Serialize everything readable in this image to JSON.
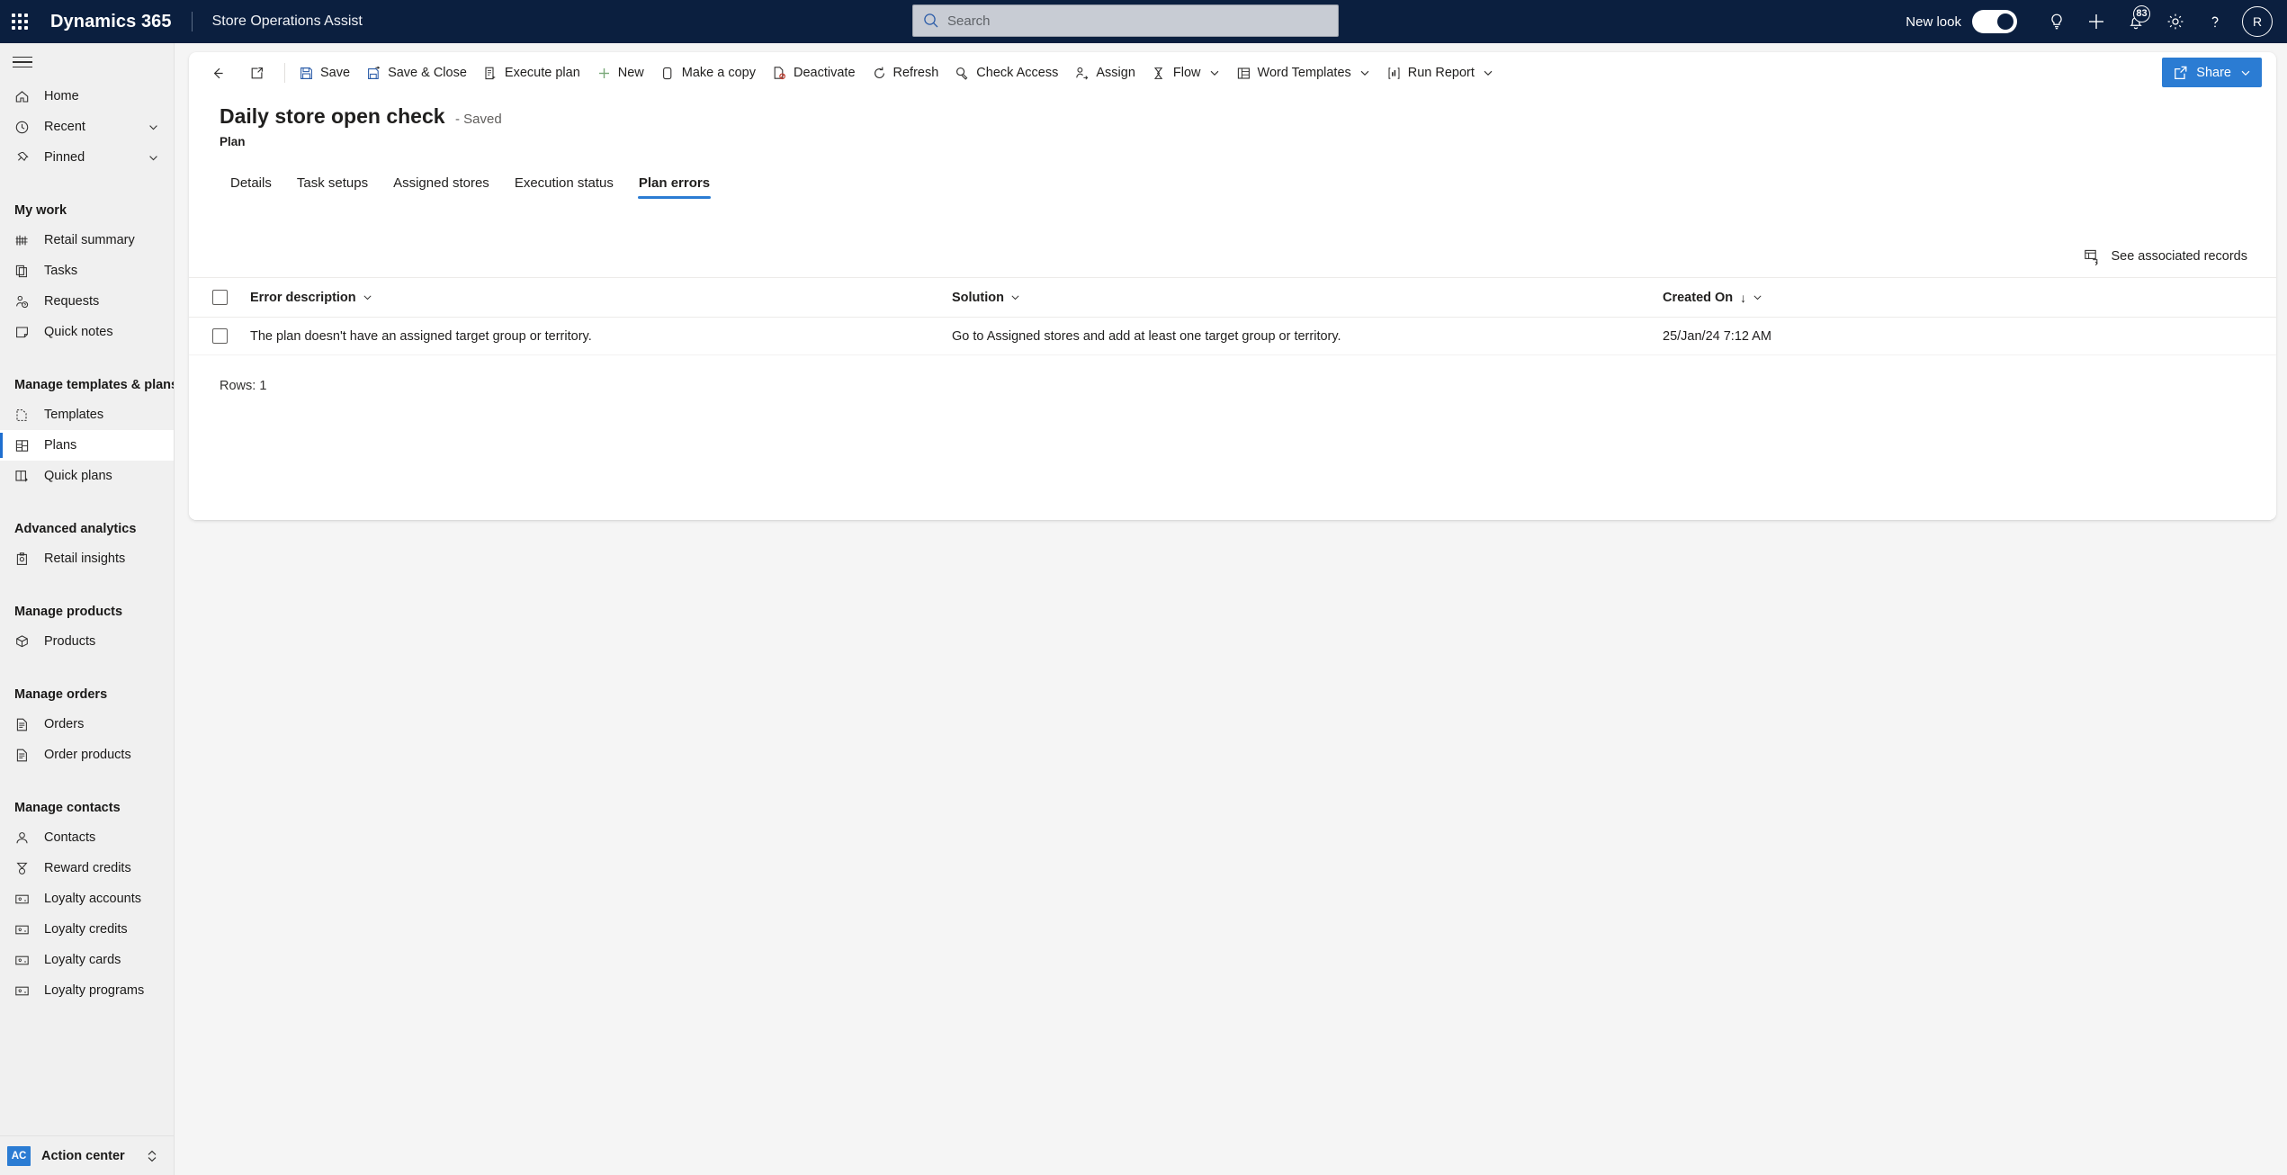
{
  "header": {
    "waffle_name": "app-launcher",
    "brand": "Dynamics 365",
    "app_name": "Store Operations Assist",
    "search_placeholder": "Search",
    "search_value": "",
    "new_look_label": "New look",
    "new_look_on": true,
    "notification_count": "83",
    "avatar_initials": "R",
    "icons": [
      "lightbulb-icon",
      "plus-icon",
      "bell-icon",
      "gear-icon",
      "help-icon"
    ]
  },
  "sidebar": {
    "top_items": [
      {
        "label": "Home",
        "icon": "home-icon",
        "chevron": false,
        "selected": false
      },
      {
        "label": "Recent",
        "icon": "clock-icon",
        "chevron": true,
        "selected": false
      },
      {
        "label": "Pinned",
        "icon": "pin-icon",
        "chevron": true,
        "selected": false
      }
    ],
    "groups": [
      {
        "title": "My work",
        "items": [
          {
            "label": "Retail summary",
            "icon": "dashboard-icon",
            "selected": false
          },
          {
            "label": "Tasks",
            "icon": "copy-icon",
            "selected": false
          },
          {
            "label": "Requests",
            "icon": "person-help-icon",
            "selected": false
          },
          {
            "label": "Quick notes",
            "icon": "note-icon",
            "selected": false
          }
        ]
      },
      {
        "title": "Manage templates & plans",
        "items": [
          {
            "label": "Templates",
            "icon": "template-icon",
            "selected": false
          },
          {
            "label": "Plans",
            "icon": "plan-icon",
            "selected": true
          },
          {
            "label": "Quick plans",
            "icon": "quick-plan-icon",
            "selected": false
          }
        ]
      },
      {
        "title": "Advanced analytics",
        "items": [
          {
            "label": "Retail insights",
            "icon": "insights-icon",
            "selected": false
          }
        ]
      },
      {
        "title": "Manage products",
        "items": [
          {
            "label": "Products",
            "icon": "box-icon",
            "selected": false
          }
        ]
      },
      {
        "title": "Manage orders",
        "items": [
          {
            "label": "Orders",
            "icon": "document-icon",
            "selected": false
          },
          {
            "label": "Order products",
            "icon": "document-icon",
            "selected": false
          }
        ]
      },
      {
        "title": "Manage contacts",
        "items": [
          {
            "label": "Contacts",
            "icon": "person-icon",
            "selected": false
          },
          {
            "label": "Reward credits",
            "icon": "medal-icon",
            "selected": false
          },
          {
            "label": "Loyalty accounts",
            "icon": "card-icon",
            "selected": false
          },
          {
            "label": "Loyalty credits",
            "icon": "card-icon",
            "selected": false
          },
          {
            "label": "Loyalty cards",
            "icon": "card-icon",
            "selected": false
          },
          {
            "label": "Loyalty programs",
            "icon": "card-icon",
            "selected": false
          }
        ]
      }
    ],
    "action_center": {
      "badge": "AC",
      "label": "Action center",
      "icon": "expand-collapse-icon"
    }
  },
  "command_bar": {
    "back_icon": "back-arrow-icon",
    "popout_icon": "open-in-new-window-icon",
    "commands": [
      {
        "label": "Save",
        "icon": "save-icon",
        "chevron": false
      },
      {
        "label": "Save & Close",
        "icon": "save-close-icon",
        "chevron": false
      },
      {
        "label": "Execute plan",
        "icon": "execute-icon",
        "chevron": false
      },
      {
        "label": "New",
        "icon": "plus-icon",
        "chevron": false
      },
      {
        "label": "Make a copy",
        "icon": "copy-icon",
        "chevron": false
      },
      {
        "label": "Deactivate",
        "icon": "deactivate-icon",
        "chevron": false
      },
      {
        "label": "Refresh",
        "icon": "refresh-icon",
        "chevron": false
      },
      {
        "label": "Check Access",
        "icon": "check-access-icon",
        "chevron": false
      },
      {
        "label": "Assign",
        "icon": "assign-icon",
        "chevron": false
      },
      {
        "label": "Flow",
        "icon": "flow-icon",
        "chevron": true
      },
      {
        "label": "Word Templates",
        "icon": "word-template-icon",
        "chevron": true
      },
      {
        "label": "Run Report",
        "icon": "report-icon",
        "chevron": true
      }
    ],
    "share": {
      "label": "Share",
      "icon": "share-icon",
      "chevron": true,
      "color": "#2b7cd3"
    }
  },
  "record": {
    "title": "Daily store open check",
    "saved_status": "- Saved",
    "entity": "Plan"
  },
  "tabs": [
    {
      "label": "Details",
      "active": false
    },
    {
      "label": "Task setups",
      "active": false
    },
    {
      "label": "Assigned stores",
      "active": false
    },
    {
      "label": "Execution status",
      "active": false
    },
    {
      "label": "Plan errors",
      "active": true
    }
  ],
  "grid": {
    "associated_records_label": "See associated records",
    "associated_records_icon": "associated-records-icon",
    "columns": [
      {
        "label": "Error description",
        "sorted": false
      },
      {
        "label": "Solution",
        "sorted": false
      },
      {
        "label": "Created On",
        "sorted": true,
        "sort_direction": "↓"
      }
    ],
    "rows": [
      {
        "error_description": "The plan doesn't have an assigned target group or territory.",
        "solution": "Go to Assigned stores and add at least one target group or territory.",
        "created_on": "25/Jan/24 7:12 AM"
      }
    ],
    "rows_label": "Rows: 1"
  }
}
